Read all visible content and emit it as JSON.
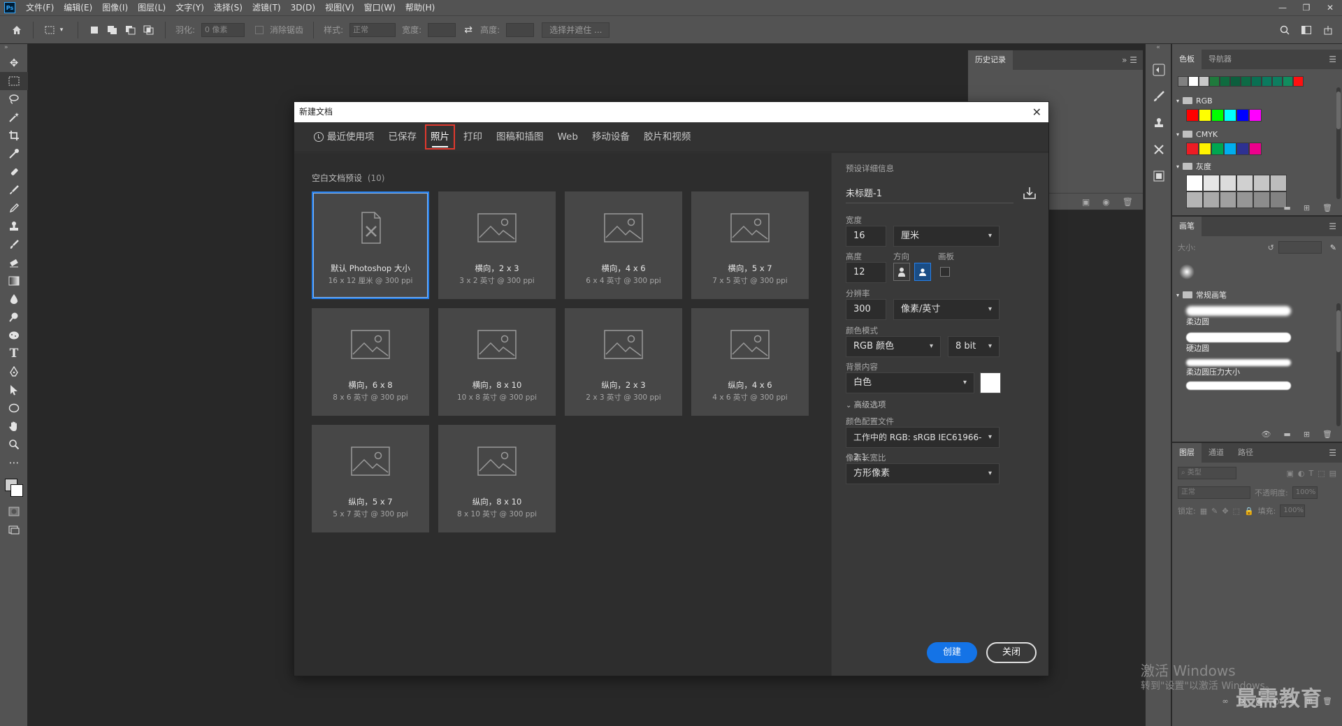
{
  "menubar": {
    "logo": "Ps",
    "items": [
      "文件(F)",
      "编辑(E)",
      "图像(I)",
      "图层(L)",
      "文字(Y)",
      "选择(S)",
      "滤镜(T)",
      "3D(D)",
      "视图(V)",
      "窗口(W)",
      "帮助(H)"
    ],
    "controls": [
      "—",
      "❐",
      "✕"
    ]
  },
  "optionsbar": {
    "feather_label": "羽化:",
    "feather_value": "0 像素",
    "antialias_label": "消除锯齿",
    "style_label": "样式:",
    "style_value": "正常",
    "width_label": "宽度:",
    "height_label": "高度:",
    "select_mask": "选择并遮住 ..."
  },
  "history": {
    "tab": "历史记录"
  },
  "rightpanels": {
    "swatches_tab": "色板",
    "navigator_tab": "导航器",
    "recent_colors": [
      "#808080",
      "#ffffff",
      "#c8c8c8",
      "#1f7a3c",
      "#0f6b3f",
      "#0c5e3d",
      "#0d6a45",
      "#0a6f52",
      "#0b7a5e",
      "#0d7d5f",
      "#108c5e",
      "#ff1010"
    ],
    "group_rgb": "RGB",
    "rgb_colors": [
      "#ff0000",
      "#ffff00",
      "#00ff00",
      "#00ffff",
      "#0000ff",
      "#ff00ff"
    ],
    "group_cmyk": "CMYK",
    "cmyk_colors": [
      "#ed1c24",
      "#fff200",
      "#00a651",
      "#00aeef",
      "#2e3192",
      "#ec008c"
    ],
    "group_gray": "灰度",
    "brush_tab": "画笔",
    "brush_size_label": "大小:",
    "brush_group": "常规画笔",
    "brushes": [
      "柔边圆",
      "硬边圆",
      "柔边圆压力大小"
    ],
    "layers_tabs": [
      "图层",
      "通道",
      "路径"
    ],
    "layer_kind": "类型",
    "blend_mode": "正常",
    "opacity_label": "不透明度:",
    "opacity_value": "100%",
    "lock_label": "锁定:",
    "fill_label": "填充:",
    "fill_value": "100%"
  },
  "dialog": {
    "title": "新建文档",
    "close": "✕",
    "tabs": [
      "最近使用项",
      "已保存",
      "照片",
      "打印",
      "图稿和插图",
      "Web",
      "移动设备",
      "胶片和视频"
    ],
    "preset_title": "空白文档预设",
    "preset_count": "(10)",
    "presets": [
      {
        "name": "默认 Photoshop 大小",
        "size": "16 x 12 厘米 @ 300 ppi"
      },
      {
        "name": "横向，2 x 3",
        "size": "3 x 2 英寸 @ 300 ppi"
      },
      {
        "name": "横向，4 x 6",
        "size": "6 x 4 英寸 @ 300 ppi"
      },
      {
        "name": "横向，5 x 7",
        "size": "7 x 5 英寸 @ 300 ppi"
      },
      {
        "name": "横向，6 x 8",
        "size": "8 x 6 英寸 @ 300 ppi"
      },
      {
        "name": "横向，8 x 10",
        "size": "10 x 8 英寸 @ 300 ppi"
      },
      {
        "name": "纵向，2 x 3",
        "size": "2 x 3 英寸 @ 300 ppi"
      },
      {
        "name": "纵向，4 x 6",
        "size": "4 x 6 英寸 @ 300 ppi"
      },
      {
        "name": "纵向，5 x 7",
        "size": "5 x 7 英寸 @ 300 ppi"
      },
      {
        "name": "纵向，8 x 10",
        "size": "8 x 10 英寸 @ 300 ppi"
      }
    ],
    "details": {
      "header": "预设详细信息",
      "doc_name": "未标题-1",
      "width_label": "宽度",
      "width_value": "16",
      "unit": "厘米",
      "height_label": "高度",
      "height_value": "12",
      "orientation_label": "方向",
      "artboard_label": "画板",
      "resolution_label": "分辨率",
      "resolution_value": "300",
      "resolution_unit": "像素/英寸",
      "color_mode_label": "颜色模式",
      "color_mode": "RGB 颜色",
      "bit_depth": "8 bit",
      "background_label": "背景内容",
      "background": "白色",
      "advanced": "高级选项",
      "profile_label": "颜色配置文件",
      "profile": "工作中的 RGB: sRGB IEC61966-2.1",
      "pixel_aspect_label": "像素长宽比",
      "pixel_aspect": "方形像素"
    },
    "create_button": "创建",
    "close_button": "关闭"
  },
  "overlay": {
    "activate_title": "激活 Windows",
    "activate_sub": "转到\"设置\"以激活 Windows。",
    "watermark": "最需教育"
  }
}
